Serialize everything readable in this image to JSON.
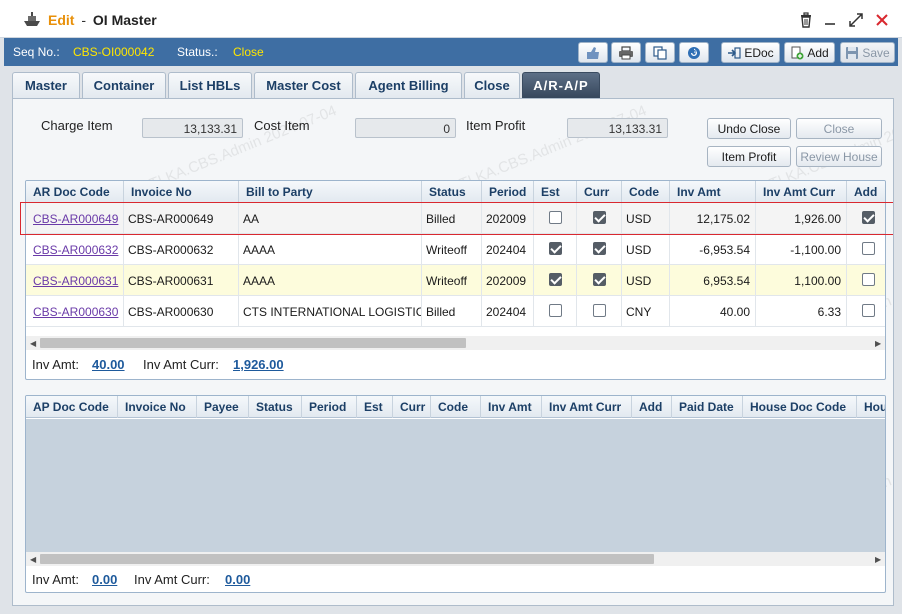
{
  "window": {
    "edit_label": "Edit",
    "separator": "-",
    "title": "OI Master"
  },
  "infobar": {
    "seq_label": "Seq No.:",
    "seq_value": "CBS-OI000042",
    "status_label": "Status.:",
    "status_value": "Close",
    "edoc_label": "EDoc",
    "add_label": "Add",
    "save_label": "Save"
  },
  "tabs": [
    {
      "label": "Master",
      "active": false
    },
    {
      "label": "Container",
      "active": false
    },
    {
      "label": "List HBLs",
      "active": false
    },
    {
      "label": "Master Cost",
      "active": false
    },
    {
      "label": "Agent Billing",
      "active": false
    },
    {
      "label": "Close",
      "active": false
    },
    {
      "label": "A/R-A/P",
      "active": true
    }
  ],
  "summary": {
    "charge_item_label": "Charge Item",
    "charge_item_value": "13,133.31",
    "cost_item_label": "Cost Item",
    "cost_item_value": "0",
    "item_profit_label": "Item Profit",
    "item_profit_value": "13,133.31"
  },
  "actions": {
    "undo_close": "Undo Close",
    "close": "Close",
    "item_profit": "Item Profit",
    "review_house": "Review House"
  },
  "watermark": "TLKA.CBS.Admin 2024-07-04",
  "ar_grid": {
    "columns": [
      "AR Doc Code",
      "Invoice No",
      "Bill to Party",
      "Status",
      "Period",
      "Est",
      "Curr",
      "Code",
      "Inv Amt",
      "Inv Amt Curr",
      "Add"
    ],
    "rows": [
      {
        "doc": "CBS-AR000649",
        "invoice": "CBS-AR000649",
        "party": "AA",
        "status": "Billed",
        "period": "202009",
        "est": false,
        "curr": true,
        "code": "USD",
        "inv_amt": "12,175.02",
        "inv_amt_curr": "1,926.00",
        "add": true,
        "selected": true
      },
      {
        "doc": "CBS-AR000632",
        "invoice": "CBS-AR000632",
        "party": "AAAA",
        "status": "Writeoff",
        "period": "202404",
        "est": true,
        "curr": true,
        "code": "USD",
        "inv_amt": "-6,953.54",
        "inv_amt_curr": "-1,100.00",
        "add": false,
        "selected": false
      },
      {
        "doc": "CBS-AR000631",
        "invoice": "CBS-AR000631",
        "party": "AAAA",
        "status": "Writeoff",
        "period": "202009",
        "est": true,
        "curr": true,
        "code": "USD",
        "inv_amt": "6,953.54",
        "inv_amt_curr": "1,100.00",
        "add": false,
        "selected": false
      },
      {
        "doc": "CBS-AR000630",
        "invoice": "CBS-AR000630",
        "party": "CTS INTERNATIONAL LOGISTICS",
        "status": "Billed",
        "period": "202404",
        "est": false,
        "curr": false,
        "code": "CNY",
        "inv_amt": "40.00",
        "inv_amt_curr": "6.33",
        "add": false,
        "selected": false
      }
    ],
    "total_label": "Inv Amt:",
    "total_value": "40.00",
    "total_curr_label": "Inv Amt Curr:",
    "total_curr_value": "1,926.00"
  },
  "ap_grid": {
    "columns": [
      "AP Doc Code",
      "Invoice No",
      "Payee",
      "Status",
      "Period",
      "Est",
      "Curr",
      "Code",
      "Inv Amt",
      "Inv Amt Curr",
      "Add",
      "Paid Date",
      "House Doc Code",
      "Hou"
    ],
    "total_label": "Inv Amt:",
    "total_value": "0.00",
    "total_curr_label": "Inv Amt Curr:",
    "total_curr_value": "0.00"
  }
}
